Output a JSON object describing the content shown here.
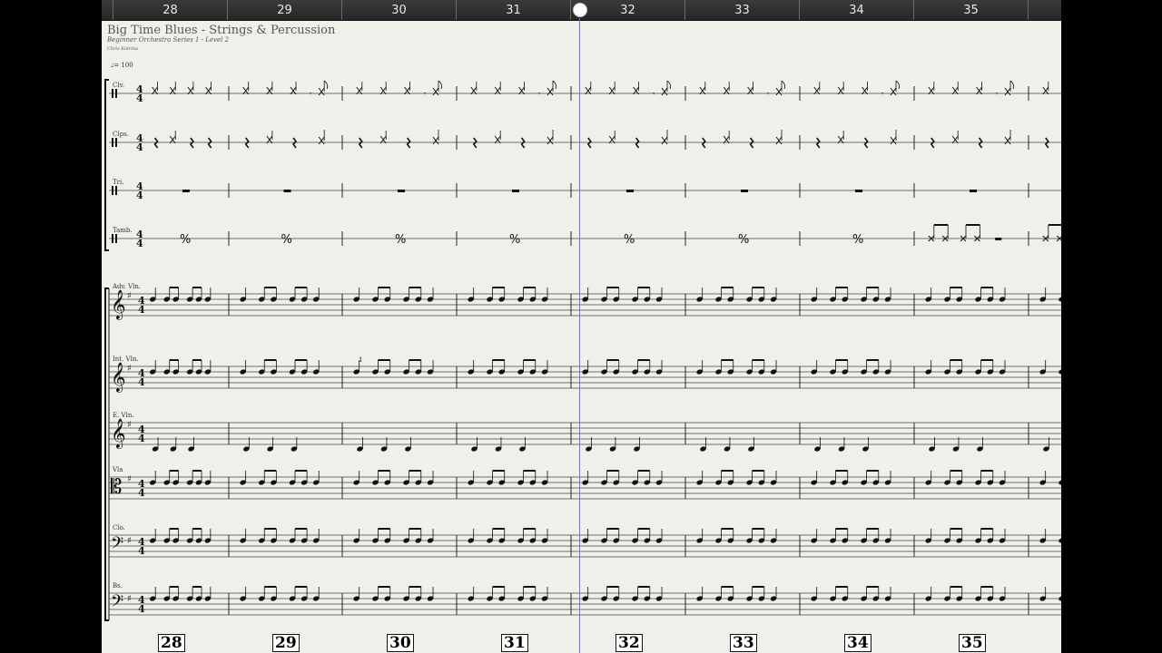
{
  "score": {
    "title": "Big Time Blues - Strings & Percussion",
    "subtitle": "Beginner Orchestra Series 1 - Level 2",
    "composer": "Chris Kotrina",
    "tempo": "♩= 100"
  },
  "timeline": {
    "measures": [
      "28",
      "29",
      "30",
      "31",
      "32",
      "33",
      "34",
      "35"
    ]
  },
  "measure_numbers": [
    "28",
    "29",
    "30",
    "31",
    "32",
    "33",
    "34",
    "35"
  ],
  "instruments": [
    {
      "label": "Clv.",
      "clef": "percussion",
      "kind": "xnotes"
    },
    {
      "label": "Clps.",
      "clef": "percussion",
      "kind": "xrests"
    },
    {
      "label": "Tri.",
      "clef": "percussion-1line",
      "kind": "wholerest"
    },
    {
      "label": "Tamb.",
      "clef": "percussion-1line",
      "kind": "repeat"
    },
    {
      "label": "Adv. Vln.",
      "clef": "treble",
      "kind": "notes"
    },
    {
      "label": "Int. Vln.",
      "clef": "treble",
      "kind": "notes"
    },
    {
      "label": "E. Vln.",
      "clef": "treble",
      "kind": "notes-low"
    },
    {
      "label": "Vla",
      "clef": "alto",
      "kind": "notes"
    },
    {
      "label": "Clo.",
      "clef": "bass",
      "kind": "notes"
    },
    {
      "label": "Bs.",
      "clef": "bass",
      "kind": "notes"
    }
  ],
  "fingering": "1",
  "symbols": {
    "time_sig_top": "4",
    "time_sig_bottom": "4",
    "treble_clef": "𝄞",
    "alto_clef": "𝄡",
    "bass_clef": "𝄢",
    "key_sharp": "♯",
    "repeat_sign": "𝄎"
  }
}
